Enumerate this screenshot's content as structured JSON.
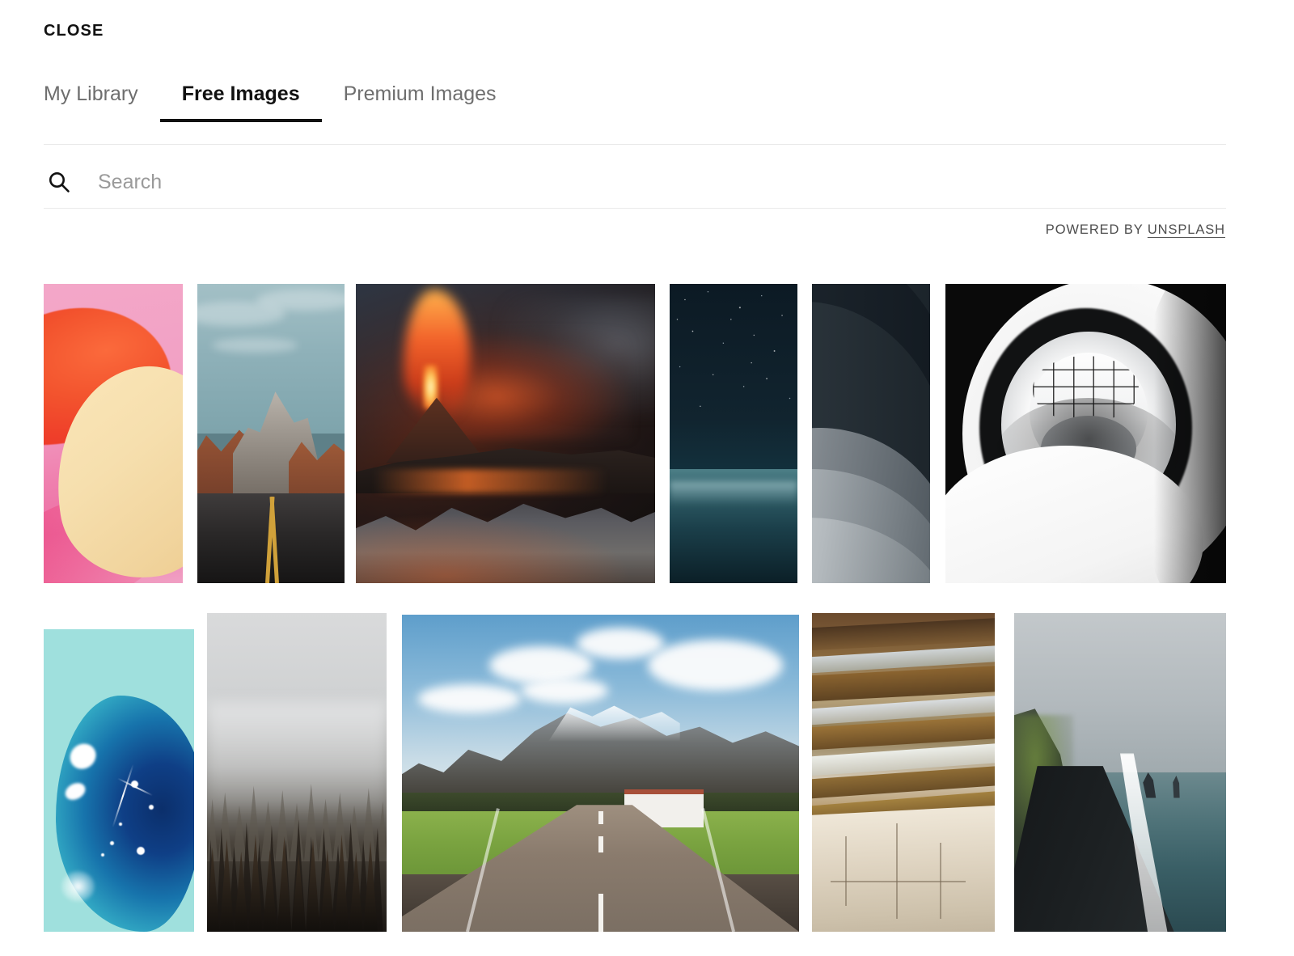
{
  "header": {
    "close_label": "CLOSE"
  },
  "tabs": [
    {
      "label": "My Library",
      "active": false
    },
    {
      "label": "Free Images",
      "active": true
    },
    {
      "label": "Premium Images",
      "active": false
    }
  ],
  "search": {
    "placeholder": "Search",
    "value": "",
    "icon": "search-icon"
  },
  "attribution": {
    "prefix": "POWERED BY ",
    "brand": "UNSPLASH"
  },
  "gallery": {
    "rows": [
      {
        "items": [
          {
            "alt": "pink and orange abstract gradient shapes"
          },
          {
            "alt": "desert road leading to red rock mountain"
          },
          {
            "alt": "painting of erupting volcano at night"
          },
          {
            "alt": "starry night sky over a dark lake"
          },
          {
            "alt": "curved dark architectural bands"
          },
          {
            "alt": "white spiral staircase from above"
          }
        ]
      },
      {
        "items": [
          {
            "alt": "blue translucent gummy blob on mint background"
          },
          {
            "alt": "foggy pine forest in black and white"
          },
          {
            "alt": "alpine road with mountains and farmhouse"
          },
          {
            "alt": "layered sedimentary rock strata"
          },
          {
            "alt": "black sand beach with sea stacks"
          }
        ]
      }
    ]
  },
  "colors": {
    "text_primary": "#111111",
    "text_muted": "#6e6e6e",
    "rule": "#e9e9e9",
    "accent_underline": "#111111",
    "background": "#ffffff"
  }
}
